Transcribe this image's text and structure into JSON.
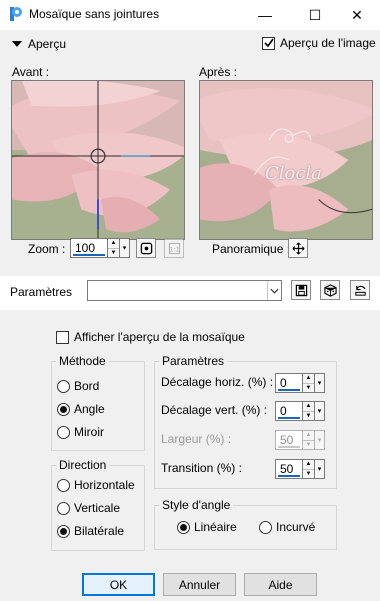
{
  "window": {
    "title": "Mosaïque sans jointures",
    "minimize_glyph": "—",
    "maximize_glyph": "☐",
    "close_glyph": "✕"
  },
  "preview_section": {
    "label": "Aperçu",
    "show_preview_label": "Aperçu de l'image",
    "show_preview_checked": true,
    "before_label": "Avant :",
    "after_label": "Après :",
    "watermark_text": "Clocla"
  },
  "zoom": {
    "label": "Zoom :",
    "value": "100"
  },
  "pan": {
    "label": "Panoramique :"
  },
  "presets": {
    "label": "Paramètres",
    "value": ""
  },
  "tile_preview": {
    "label": "Afficher l'aperçu de la mosaïque",
    "checked": false
  },
  "method": {
    "title": "Méthode",
    "options": [
      "Bord",
      "Angle",
      "Miroir"
    ],
    "selected": "Angle"
  },
  "direction": {
    "title": "Direction",
    "options": [
      "Horizontale",
      "Verticale",
      "Bilatérale"
    ],
    "selected": "Bilatérale"
  },
  "params": {
    "title": "Paramètres",
    "h_offset_label": "Décalage horiz. (%) :",
    "h_offset_value": "0",
    "v_offset_label": "Décalage vert. (%) :",
    "v_offset_value": "0",
    "width_label": "Largeur (%) :",
    "width_value": "50",
    "transition_label": "Transition (%) :",
    "transition_value": "50"
  },
  "corner_style": {
    "title": "Style d'angle",
    "options": [
      "Linéaire",
      "Incurvé"
    ],
    "selected": "Linéaire"
  },
  "buttons": {
    "ok": "OK",
    "cancel": "Annuler",
    "help": "Aide"
  },
  "colors": {
    "accent": "#0078d7",
    "petal": "#e9b3b7",
    "background_green": "#9aa88a"
  }
}
